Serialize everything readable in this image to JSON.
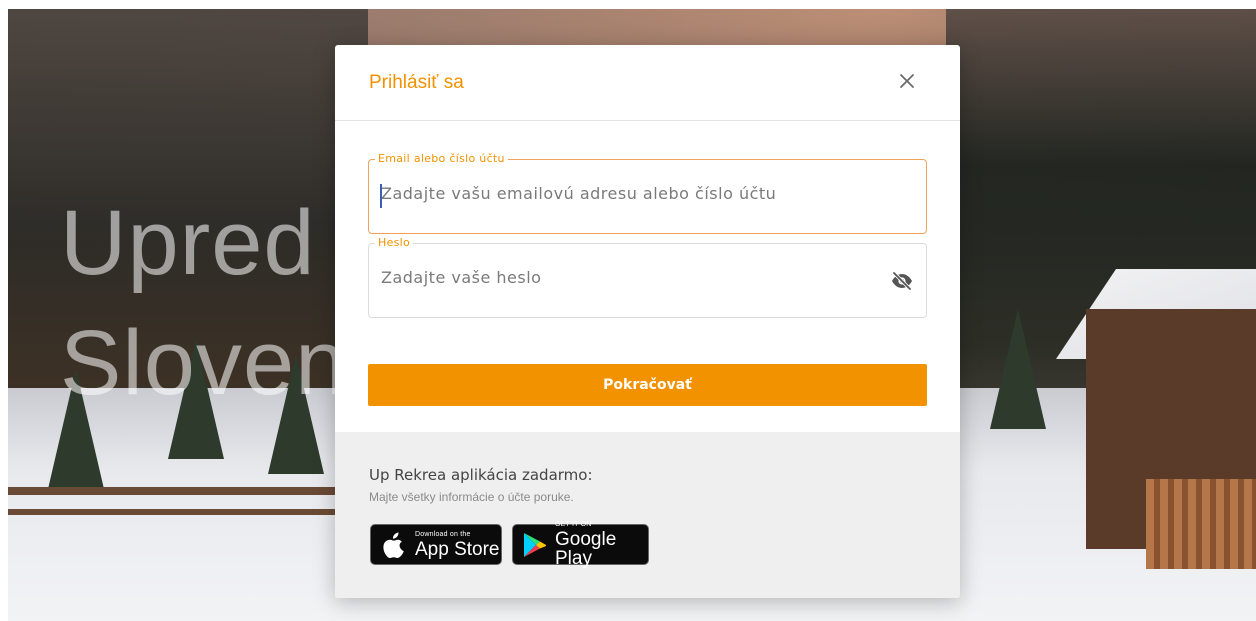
{
  "background": {
    "hero_lines": [
      "Upred",
      "Sloven"
    ]
  },
  "modal": {
    "title": "Prihlásiť sa",
    "close_icon": "close-icon",
    "email": {
      "label": "Email alebo číslo účtu",
      "placeholder": "Zadajte vašu emailovú adresu alebo číslo účtu",
      "value": ""
    },
    "password": {
      "label": "Heslo",
      "placeholder": "Zadajte vaše heslo",
      "value": "",
      "toggle_icon": "eye-slash-icon"
    },
    "submit_label": "Pokračovať",
    "footer": {
      "title": "Up Rekrea aplikácia zadarmo:",
      "subtitle": "Majte všetky informácie o účte poruke.",
      "app_store": {
        "small": "Download on the",
        "big": "App Store"
      },
      "google_play": {
        "small": "GET IT ON",
        "big": "Google Play"
      }
    }
  },
  "colors": {
    "accent": "#f39200",
    "active_border": "#f0a25a",
    "footer_bg": "#efefef"
  }
}
